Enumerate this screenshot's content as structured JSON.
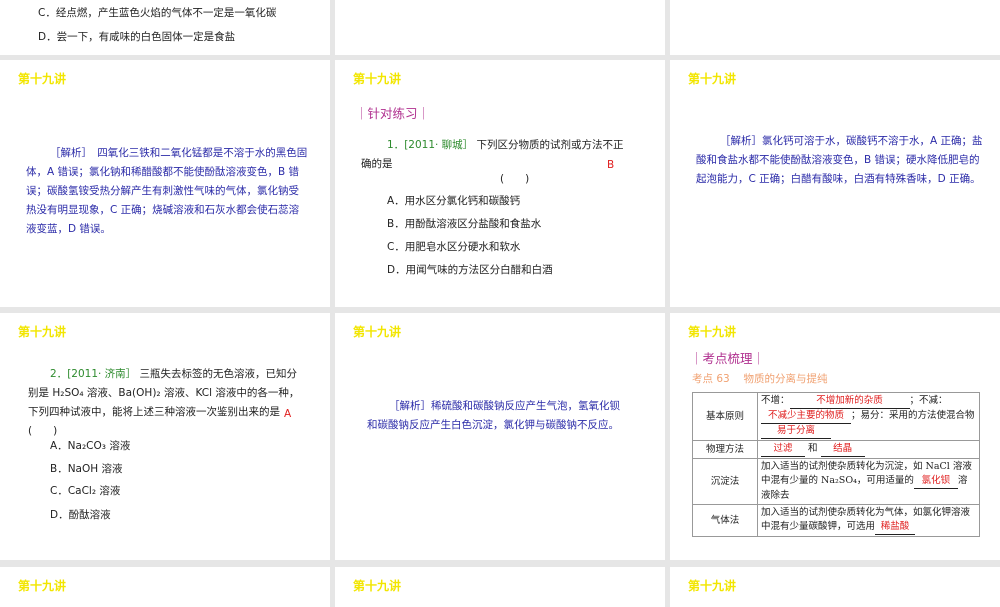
{
  "header_label": "第十九讲",
  "slide0": {
    "opt_c": "C．经点燃，产生蓝色火焰的气体不一定是一氧化碳",
    "opt_d": "D．尝一下，有咸味的白色固体一定是食盐"
  },
  "slide1": {
    "analysis": "［解析］　四氧化三铁和二氧化锰都是不溶于水的黑色固体，A 错误；氯化钠和稀醋酸都不能使酚酞溶液变色，B 错误；碳酸氢铵受热分解产生有刺激性气味的气体，氯化钠受热没有明显现象，C 正确；烧碱溶液和石灰水都会使石蕊溶液变蓝，D 错误。"
  },
  "slide2": {
    "section": "｜针对练习｜",
    "num": "1．",
    "source": "[2011· 聊城］",
    "question": "下列区分物质的试剂或方法不正确的是",
    "answer": "B",
    "paren": "(　　)",
    "options": [
      "A．用水区分氯化钙和碳酸钙",
      "B．用酚酞溶液区分盐酸和食盐水",
      "C．用肥皂水区分硬水和软水",
      "D．用闻气味的方法区分白醋和白酒"
    ]
  },
  "slide3": {
    "analysis": "［解析］氯化钙可溶于水，碳酸钙不溶于水，A 正确；盐酸和食盐水都不能使酚酞溶液变色，B 错误；硬水降低肥皂的起泡能力，C 正确；白醋有酸味，白酒有特殊香味，D 正确。"
  },
  "slide4": {
    "num": "2．",
    "source": "[2011· 济南］",
    "question": "三瓶失去标签的无色溶液，已知分别是 H₂SO₄ 溶液、Ba(OH)₂ 溶液、KCl 溶液中的各一种，下列四种试液中，能将上述三种溶液一次鉴别出来的是(　　)",
    "answer": "A",
    "options": [
      "A．Na₂CO₃ 溶液",
      "B．NaOH 溶液",
      "C．CaCl₂ 溶液",
      "D．酚酞溶液"
    ]
  },
  "slide5": {
    "analysis": "［解析］稀硫酸和碳酸钠反应产生气泡，氢氧化钡和碳酸钠反应产生白色沉淀，氯化钾与碳酸钠不反应。"
  },
  "slide6": {
    "section": "｜考点梳理｜",
    "topic": "考点 63　 物质的分离与提纯",
    "rows": [
      {
        "key": "基本原则",
        "a": "不增：",
        "a_ans": "不增加新的杂质",
        "b": "；不减：",
        "b_ans": "不减少主要的物质",
        "c": "；易分：采用的方法使混合物",
        "c_ans": "易于分离"
      },
      {
        "key": "物理方法",
        "ans1": "过滤",
        "mid": "和",
        "ans2": "结晶"
      },
      {
        "key": "沉淀法",
        "text": "加入适当的试剂使杂质转化为沉淀，如 NaCl 溶液中混有少量的 Na₂SO₄，可用适量的",
        "ans": "氯化钡",
        "tail": "溶液除去"
      },
      {
        "key": "气体法",
        "text": "加入适当的试剂使杂质转化为气体，如氯化钾溶液中混有少量碳酸钾，可选用",
        "ans": "稀盐酸"
      }
    ]
  }
}
